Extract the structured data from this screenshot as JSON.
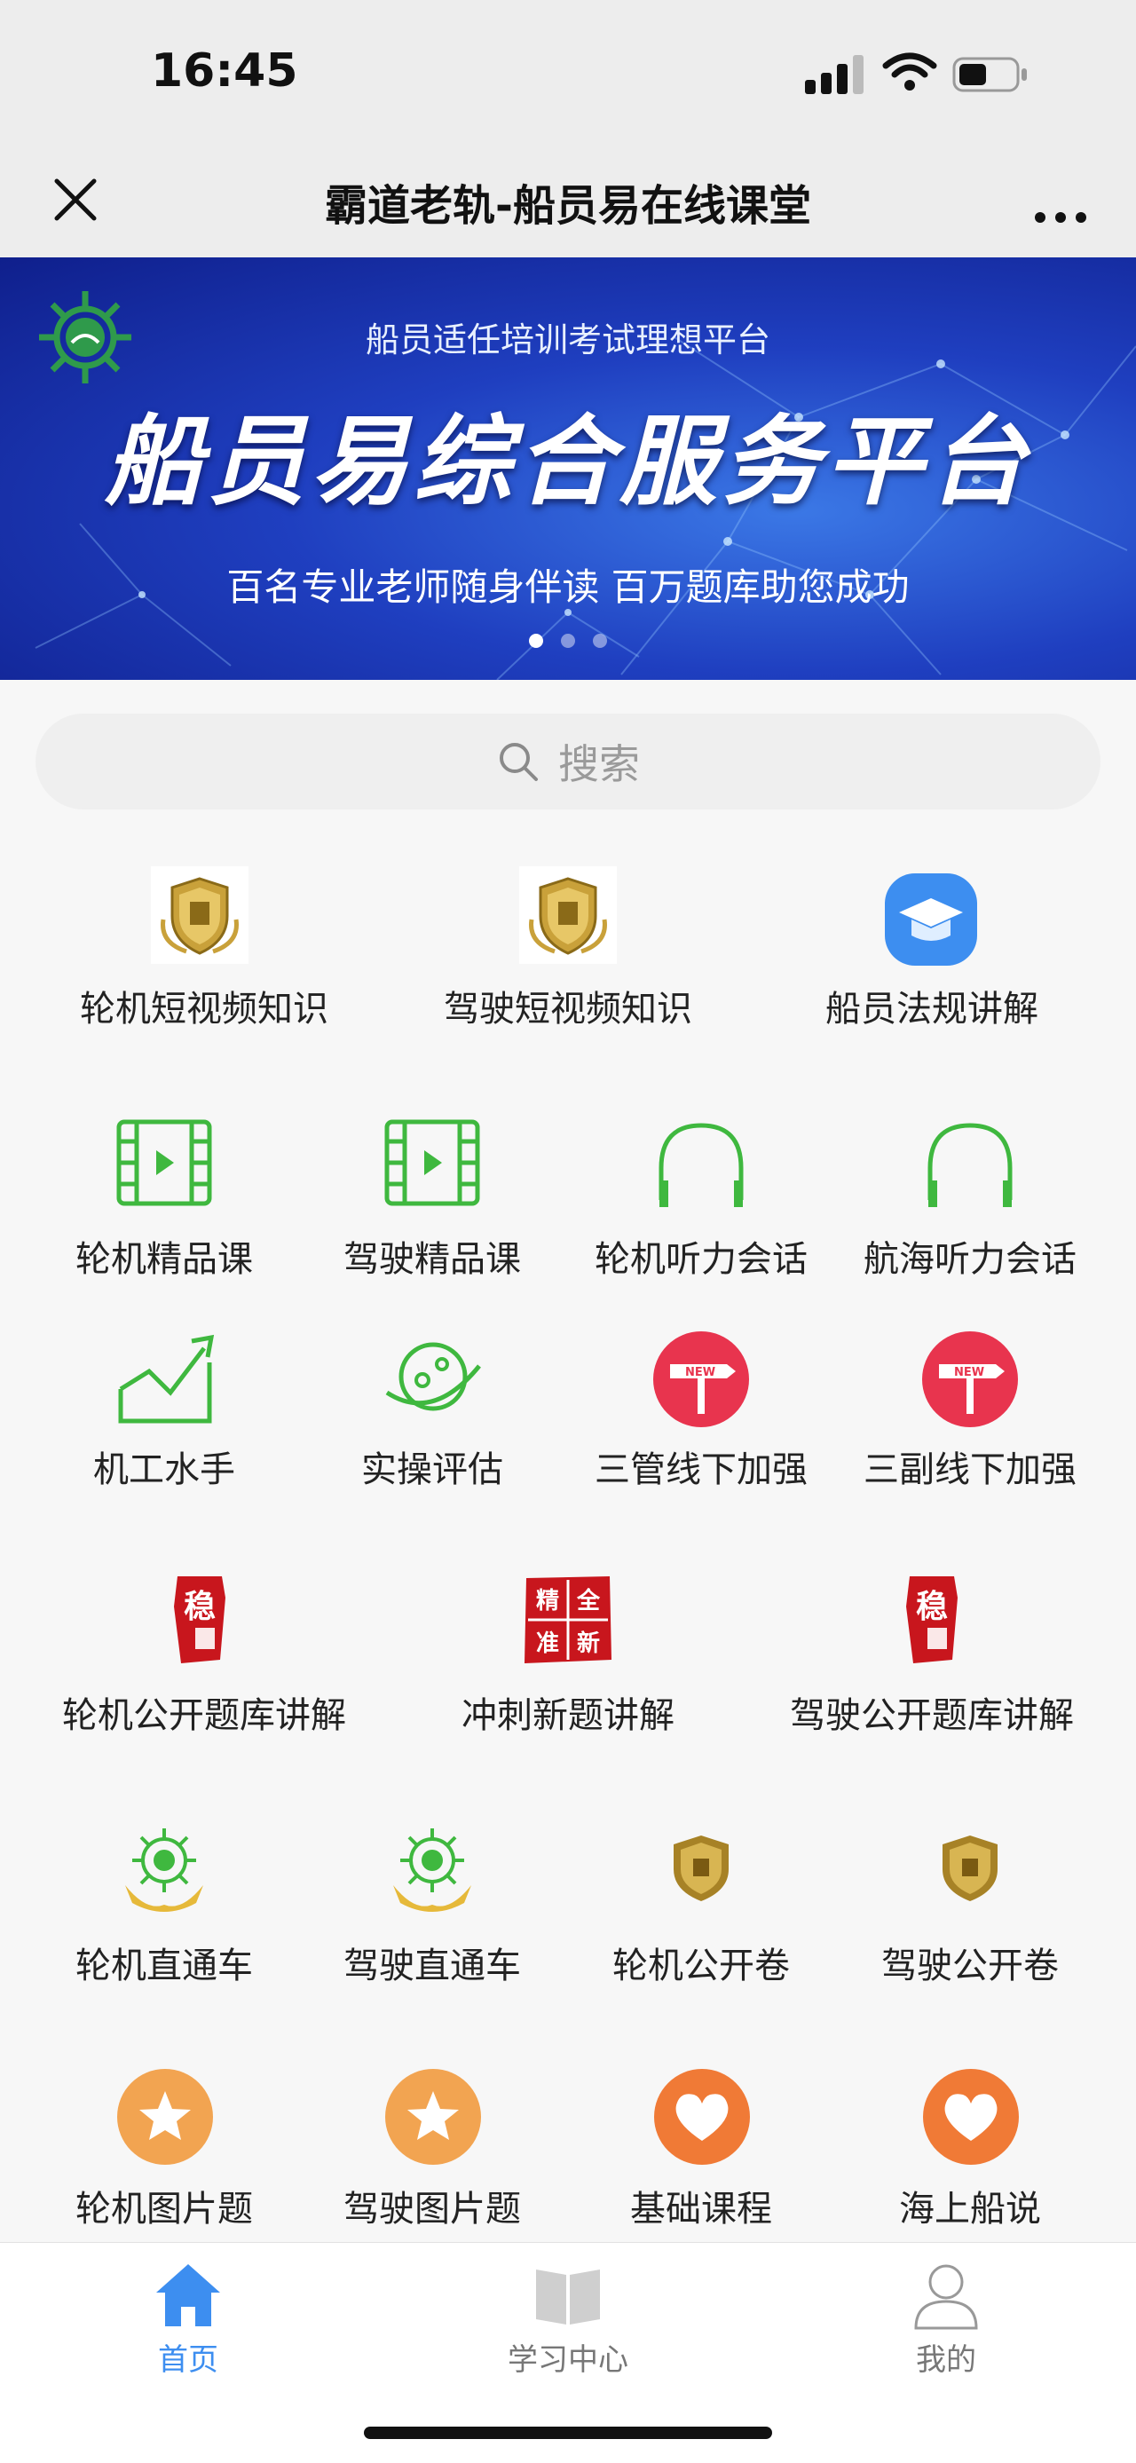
{
  "status_bar": {
    "time": "16:45"
  },
  "nav": {
    "title": "霸道老轨-船员易在线课堂"
  },
  "banner": {
    "subtitle": "船员适任培训考试理想平台",
    "headline": "船员易综合服务平台",
    "tagline": "百名专业老师随身伴读  百万题库助您成功"
  },
  "search": {
    "placeholder": "搜索"
  },
  "grid": {
    "row1": [
      "轮机短视频知识",
      "驾驶短视频知识",
      "船员法规讲解"
    ],
    "row2": [
      "轮机精品课",
      "驾驶精品课",
      "轮机听力会话",
      "航海听力会话"
    ],
    "row3": [
      "机工水手",
      "实操评估",
      "三管线下加强",
      "三副线下加强"
    ],
    "row4": [
      "轮机公开题库讲解",
      "冲刺新题讲解",
      "驾驶公开题库讲解"
    ],
    "row5": [
      "轮机直通车",
      "驾驶直通车",
      "轮机公开卷",
      "驾驶公开卷"
    ],
    "row6": [
      "轮机图片题",
      "驾驶图片题",
      "基础课程",
      "海上船说"
    ]
  },
  "icon_badges": {
    "new": "NEW",
    "seal_a": "稳",
    "seal_b": "精全准新"
  },
  "tabs": [
    {
      "label": "首页",
      "icon": "home-icon",
      "active": true
    },
    {
      "label": "学习中心",
      "icon": "book-icon",
      "active": false
    },
    {
      "label": "我的",
      "icon": "user-icon",
      "active": false
    }
  ],
  "colors": {
    "accent": "#3d8ef0",
    "green": "#3fb83f",
    "red": "#e8344e",
    "orange": "#f07a36"
  }
}
